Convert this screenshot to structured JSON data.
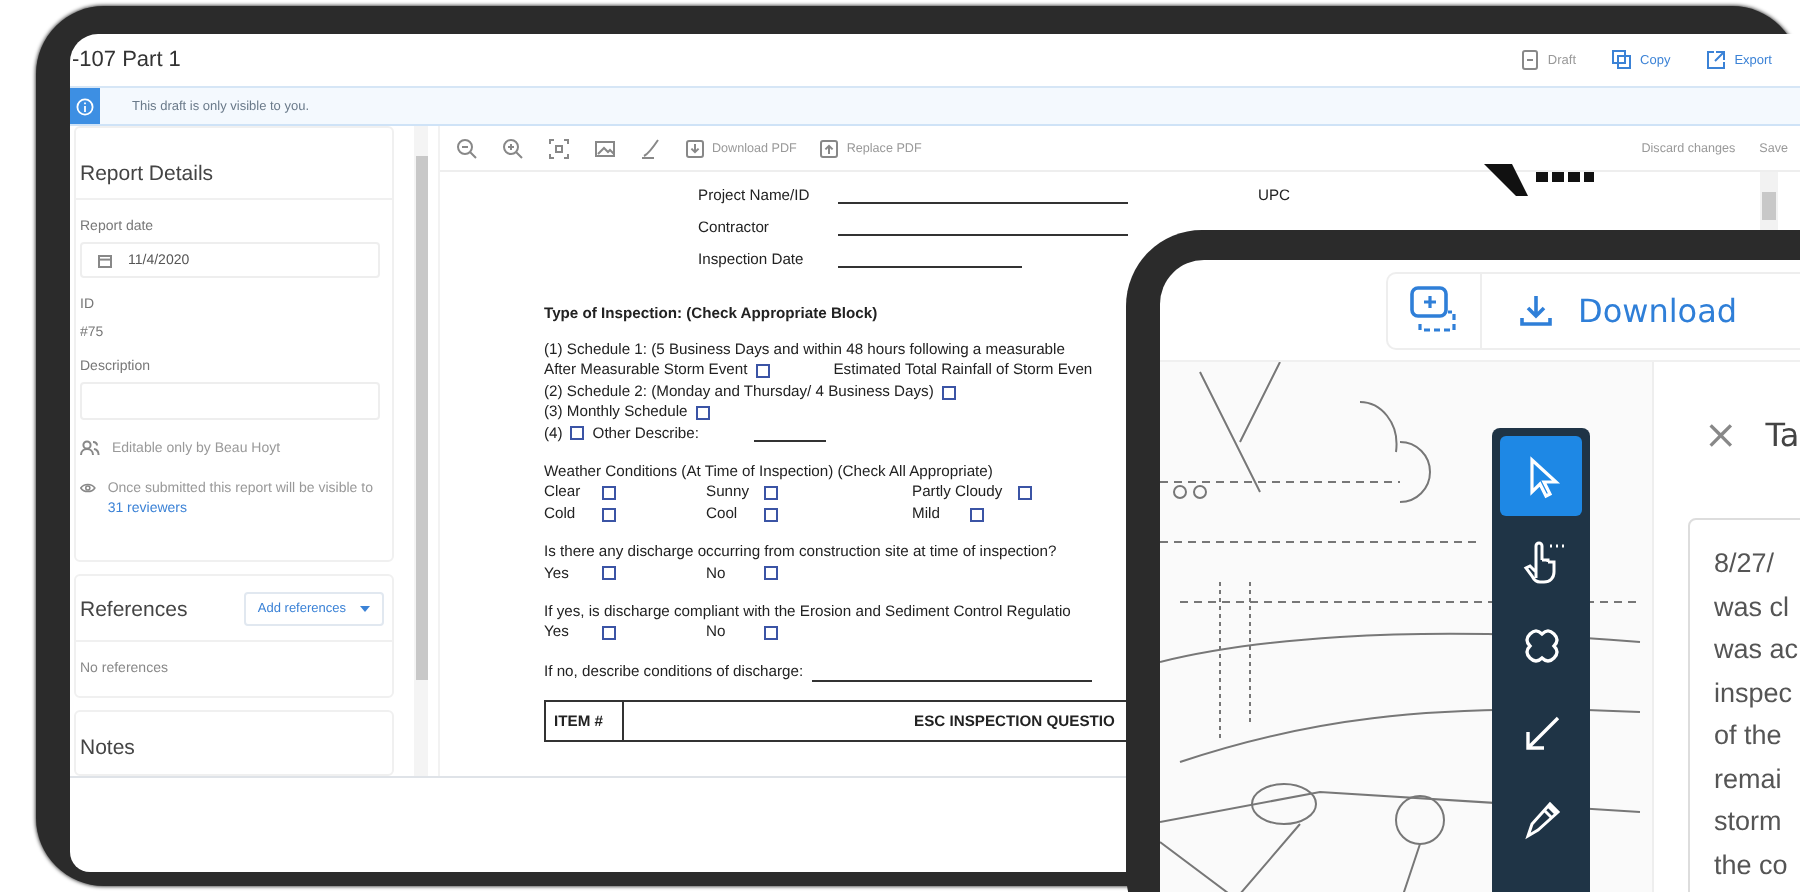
{
  "report": {
    "title": "-107 Part 1",
    "actions": [
      {
        "label": "Draft",
        "kind": "draft"
      },
      {
        "label": "Copy",
        "kind": "copy"
      },
      {
        "label": "Export",
        "kind": "export"
      }
    ],
    "banner": "This draft is only visible to you.",
    "details": {
      "heading": "Report Details",
      "date_label": "Report date",
      "date": "11/4/2020",
      "id_label": "ID",
      "id": "#75",
      "description_label": "Description",
      "editable": "Editable only by Beau Hoyt",
      "visibility": "Once submitted this report will be visible to",
      "reviewers": "31 reviewers"
    },
    "references": {
      "heading": "References",
      "add_button": "Add references",
      "empty": "No references"
    },
    "notes": {
      "heading": "Notes"
    },
    "toolbar": {
      "buttons": [
        {
          "label": "Download PDF",
          "kind": "download"
        },
        {
          "label": "Replace PDF",
          "kind": "upload"
        }
      ],
      "discard": "Discard changes",
      "save": "Save"
    },
    "document": {
      "fields": [
        {
          "label": "Project Name/ID"
        },
        {
          "label": "Contractor"
        },
        {
          "label": "Inspection Date"
        }
      ],
      "upc": "UPC",
      "blocks": [
        {
          "kind": "heading",
          "text": "Type of Inspection:  (Check Appropriate Block)"
        },
        {
          "kind": "lines",
          "rows": [
            [
              {
                "kind": "text",
                "text": "(1) Schedule 1: (5 Business Days and within 48 hours following a measurable"
              }
            ],
            [
              {
                "kind": "text",
                "text": "After Measurable Storm Event"
              },
              {
                "kind": "box",
                "checked": false
              },
              {
                "kind": "gap"
              },
              {
                "kind": "text",
                "text": "Estimated Total Rainfall of Storm Even"
              }
            ],
            [
              {
                "kind": "text",
                "text": "(2) Schedule 2: (Monday and Thursday/ 4 Business Days)"
              },
              {
                "kind": "box",
                "checked": false
              }
            ],
            [
              {
                "kind": "text",
                "text": "(3) Monthly Schedule"
              },
              {
                "kind": "box",
                "checked": false
              }
            ],
            [
              {
                "kind": "text",
                "text": "(4)"
              },
              {
                "kind": "box",
                "checked": false
              },
              {
                "kind": "text",
                "text": "Other Describe:"
              },
              {
                "kind": "blank"
              }
            ]
          ]
        },
        {
          "kind": "grid",
          "title": "Weather Conditions (At Time of Inspection) (Check All Appropriate)",
          "rows": [
            [
              {
                "label": "Clear",
                "checked": false
              },
              {
                "label": "Sunny",
                "checked": false
              },
              {
                "label": "Partly Cloudy",
                "checked": false
              }
            ],
            [
              {
                "label": "Cold",
                "checked": false
              },
              {
                "label": "Cool",
                "checked": false
              },
              {
                "label": "Mild",
                "checked": false
              }
            ]
          ]
        },
        {
          "kind": "grid",
          "title": "Is there any discharge occurring from construction site at time of inspection?",
          "rows": [
            [
              {
                "label": "Yes",
                "checked": false
              },
              {
                "label": "No",
                "checked": false
              }
            ]
          ]
        },
        {
          "kind": "grid",
          "title": "If yes, is discharge compliant with the Erosion and Sediment Control Regulatio",
          "rows": [
            [
              {
                "label": "Yes",
                "checked": false
              },
              {
                "label": "No",
                "checked": false
              }
            ]
          ]
        },
        {
          "kind": "lines",
          "rows": [
            [
              {
                "kind": "text",
                "text": "If no, describe conditions of discharge:"
              },
              {
                "kind": "rule"
              }
            ]
          ]
        },
        {
          "kind": "table",
          "columns": [
            "ITEM #",
            "ESC INSPECTION QUESTIO"
          ]
        }
      ]
    }
  },
  "viewer": {
    "download": "Download",
    "tools": [
      {
        "kind": "select",
        "selected": true
      },
      {
        "kind": "pan",
        "selected": false
      },
      {
        "kind": "cloud",
        "selected": false
      },
      {
        "kind": "arrow",
        "selected": false
      },
      {
        "kind": "pen",
        "selected": false
      }
    ],
    "panel": {
      "close": "×",
      "title": "Ta",
      "lines": [
        "8/27/",
        "was cl",
        "was ac",
        "inspec",
        "of the",
        "remai",
        "storm",
        "the co"
      ]
    }
  }
}
